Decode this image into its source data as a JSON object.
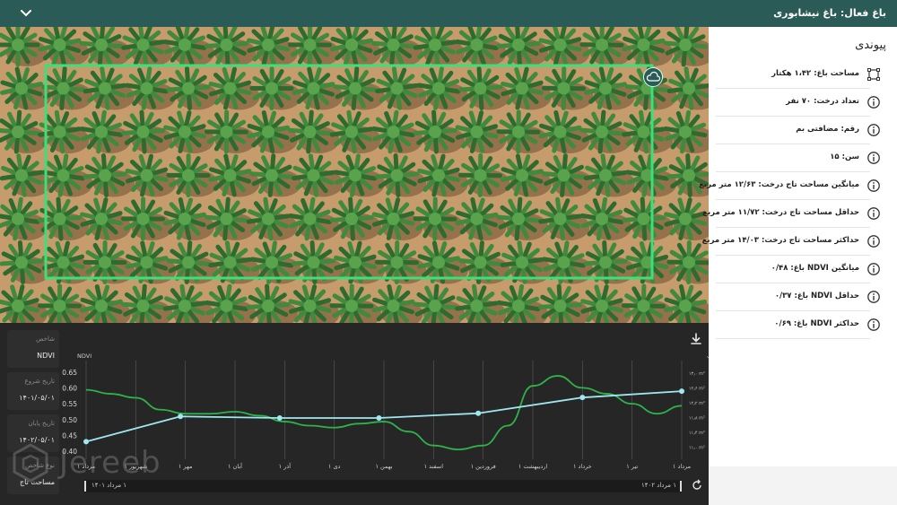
{
  "header": {
    "title": "باغ فعال: باغ نیشابوری"
  },
  "panel": {
    "title": "پیوندی",
    "items": [
      {
        "label": "مساحت باغ: ۱،۴۲ هکتار",
        "icon": "area-frame-icon"
      },
      {
        "label": "تعداد درخت: ۷۰ نفر",
        "icon": "info-icon"
      },
      {
        "label": "رقم: مضافتی بم",
        "icon": "info-icon"
      },
      {
        "label": "سن: ۱۵",
        "icon": "info-icon"
      },
      {
        "label": "میانگین مساحت تاج درخت: ۱۲/۶۳ متر مربع",
        "icon": "info-icon"
      },
      {
        "label": "حداقل مساحت تاج درخت: ۱۱/۷۲ متر مربع",
        "icon": "info-icon"
      },
      {
        "label": "حداکثر مساحت تاج درخت: ۱۴/۰۳ متر مربع",
        "icon": "info-icon"
      },
      {
        "label": "میانگین NDVI باغ: ۰/۴۸",
        "icon": "info-icon"
      },
      {
        "label": "حداقل NDVI باغ: ۰/۳۷",
        "icon": "info-icon"
      },
      {
        "label": "حداکثر NDVI باغ: ۰/۶۹",
        "icon": "info-icon"
      }
    ]
  },
  "filters": {
    "index_label": "شاخص",
    "index_value": "NDVI",
    "start_label": "تاریخ شروع",
    "start_value": "۱۴۰۱/۰۵/۰۱",
    "end_label": "تاریخ پایان",
    "end_value": "۱۴۰۲/۰۵/۰۱",
    "metric_label": "نوع شاخص",
    "metric_value": "مساحت تاج"
  },
  "range": {
    "left_label": "۱ مرداد ۱۴۰۱",
    "right_label": "۱ مرداد ۱۴۰۲"
  },
  "watermark": {
    "text": "Jereeb"
  },
  "colors": {
    "header": "#2b5b57",
    "ndvi_line": "#9fe8f0",
    "crown_line": "#2fb24a",
    "field_box": "#3be07a"
  },
  "chart_data": {
    "type": "line",
    "left_axis_label": "NDVI",
    "right_axis_label": "مساحت تاج درخت",
    "categories": [
      "۱ مرداد",
      "۱ شهریور",
      "۱ مهر",
      "۱ آبان",
      "۱ آذر",
      "۱ دی",
      "۱ بهمن",
      "۱ اسفند",
      "۱ فروردین",
      "۱ اردیبهشت",
      "۱ خرداد",
      "۱ تیر",
      "۱ مرداد"
    ],
    "left_ticks": [
      "0.45",
      "0.50",
      "0.55",
      "0.60",
      "0.65",
      "0.40"
    ],
    "left_tick_values": [
      0.45,
      0.5,
      0.55,
      0.6,
      0.65,
      0.4
    ],
    "right_ticks": [
      "۱۳٫۰ m²",
      "۱۲٫۶ m²",
      "۱۲٫۲ m²",
      "۱۱٫۸ m²",
      "۱۱٫۴ m²",
      "۱۱٫۰ m²"
    ],
    "ylim_left": [
      0.38,
      0.67
    ],
    "ylim_right": [
      10.9,
      13.2
    ],
    "grid": "vertical",
    "series": [
      {
        "name": "NDVI",
        "x": [
          0,
          1.9,
          3.9,
          5.9,
          7.9,
          10.0,
          12.0
        ],
        "values": [
          0.43,
          0.51,
          0.505,
          0.505,
          0.52,
          0.57,
          0.59
        ]
      },
      {
        "name": "مساحت تاج",
        "x": [
          0,
          0.5,
          1,
          1.5,
          2,
          2.5,
          3,
          3.5,
          4,
          4.5,
          5,
          5.5,
          6,
          6.5,
          7,
          7.5,
          8,
          8.5,
          9,
          9.5,
          10,
          10.5,
          11,
          11.5,
          12
        ],
        "values": [
          12.6,
          12.5,
          12.4,
          12.1,
          12.0,
          12.0,
          12.05,
          11.95,
          11.8,
          11.7,
          11.65,
          11.75,
          11.8,
          11.55,
          11.2,
          11.1,
          11.2,
          11.7,
          12.7,
          12.95,
          12.65,
          12.5,
          12.25,
          12.0,
          12.2
        ]
      }
    ]
  }
}
